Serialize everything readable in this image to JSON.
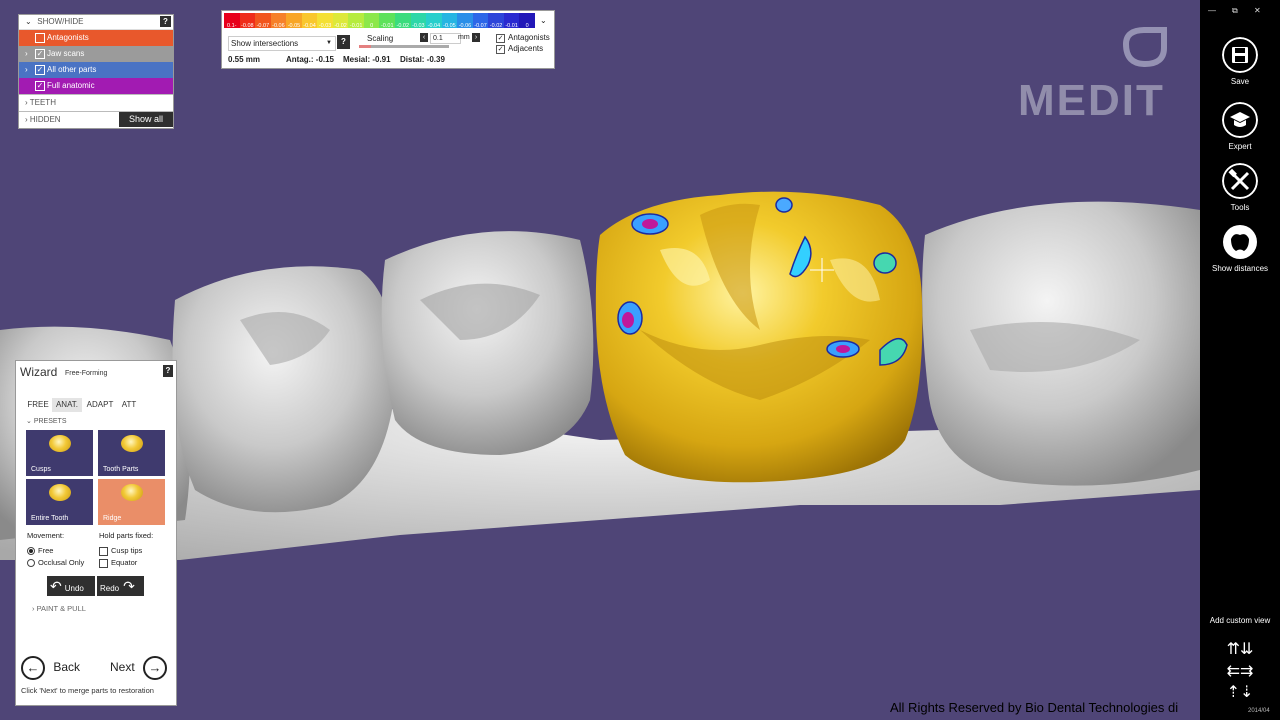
{
  "showhide": {
    "title": "SHOW/HIDE",
    "help": "?",
    "items": [
      {
        "label": "Antagonists",
        "checked": false,
        "color": "#e8582c"
      },
      {
        "label": "Jaw scans",
        "checked": true,
        "color": "#9b9b9b"
      },
      {
        "label": "All other parts",
        "checked": true,
        "color": "#4a73c4"
      },
      {
        "label": "Full anatomic",
        "checked": true,
        "color": "#a21bb2"
      }
    ],
    "teeth_label": "TEETH",
    "hidden_label": "HIDDEN",
    "show_all": "Show all"
  },
  "deviation": {
    "color_labels": [
      "0.1-0.09",
      "-0.08",
      "-0.07",
      "-0.06",
      "-0.05",
      "-0.04",
      "-0.03",
      "-0.02",
      "-0.01",
      "0",
      "-0.01",
      "-0.02",
      "-0.03",
      "-0.04",
      "-0.05",
      "-0.06",
      "-0.07",
      "-0.02",
      "-0.01",
      "0"
    ],
    "colors": [
      "#e8001b",
      "#ef2d1a",
      "#f2561e",
      "#f6812a",
      "#f8a626",
      "#f9c72d",
      "#f4e034",
      "#dde93a",
      "#b6ec3e",
      "#8ce84a",
      "#5ee25a",
      "#3bdc7d",
      "#2dd7a8",
      "#27cfcc",
      "#26b5e2",
      "#2a8fe8",
      "#2d67e8",
      "#2d45d9",
      "#2a2ad0",
      "#2218b8"
    ],
    "mode": "Show intersections",
    "help": "?",
    "scaling_label": "Scaling",
    "scaling_value": "0.1",
    "unit": "mm",
    "check_antagonists": "Antagonists",
    "check_adjacents": "Adjacents",
    "dist": "0.55 mm",
    "antag": "Antag.: -0.15",
    "mesial": "Mesial: -0.91",
    "distal": "Distal: -0.39"
  },
  "brand": "MEDIT",
  "toolbar": {
    "window_controls": [
      "—",
      "⧉",
      "✕"
    ],
    "save": "Save",
    "expert": "Expert",
    "tools": "Tools",
    "show_distances": "Show distances",
    "add_custom_view": "Add custom view"
  },
  "wizard": {
    "title": "Wizard",
    "subtitle": "Free-Forming",
    "help": "?",
    "tabs": [
      "FREE",
      "ANAT.",
      "ADAPT",
      "ATT"
    ],
    "active_tab": "ANAT.",
    "presets_label": "PRESETS",
    "tiles": [
      {
        "label": "Cusps",
        "color": "#3f3a6e"
      },
      {
        "label": "Tooth Parts",
        "color": "#3f3a6e"
      },
      {
        "label": "Entire Tooth",
        "color": "#3f3a6e"
      },
      {
        "label": "Ridge",
        "color": "#ea8e68"
      }
    ],
    "movement_label": "Movement:",
    "movement_free": "Free",
    "movement_occlusal": "Occlusal Only",
    "hold_label": "Hold parts fixed:",
    "hold_cusp": "Cusp tips",
    "hold_equator": "Equator",
    "undo": "Undo",
    "redo": "Redo",
    "paint_pull": "PAINT & PULL",
    "back": "Back",
    "next": "Next",
    "hint": "Click 'Next' to merge parts to restoration"
  },
  "footer": {
    "copyright": "All Rights Reserved by Bio Dental Technologies di",
    "datetag": "2014/04"
  }
}
